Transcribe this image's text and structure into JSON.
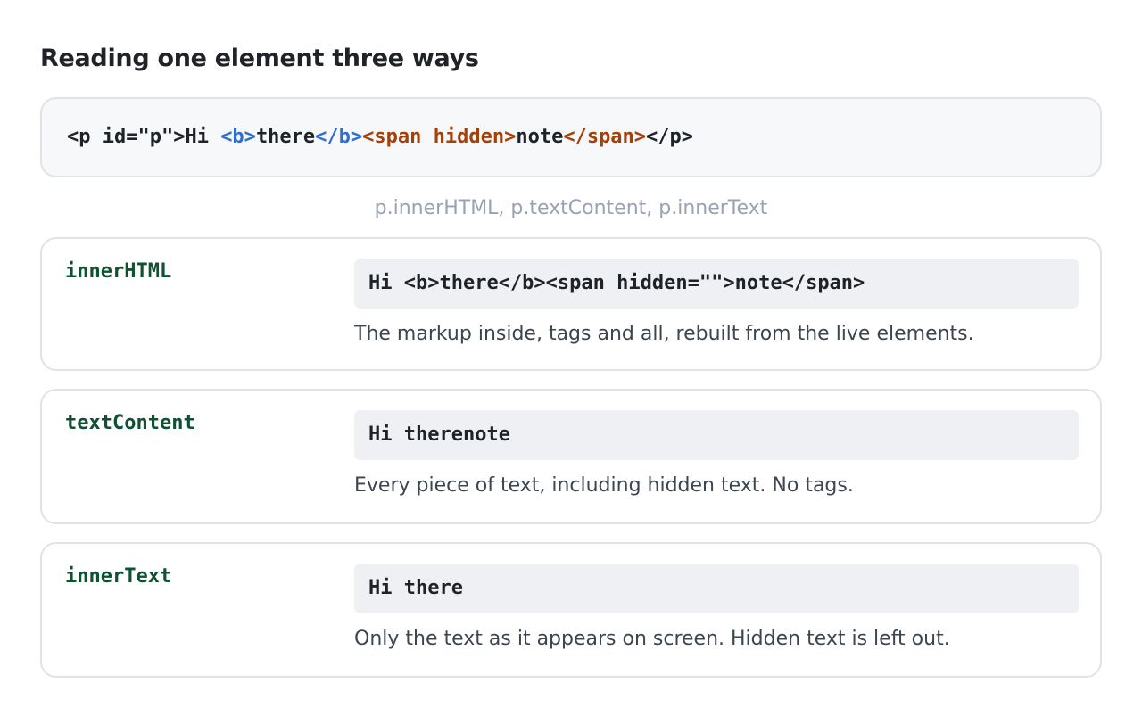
{
  "title": "Reading one element three ways",
  "source": {
    "tokens": [
      {
        "text": "<p id=\"p\">Hi ",
        "color": "default"
      },
      {
        "text": "<b>",
        "color": "blue"
      },
      {
        "text": "there",
        "color": "default"
      },
      {
        "text": "</b>",
        "color": "blue"
      },
      {
        "text": "<span hidden>",
        "color": "rust"
      },
      {
        "text": "note",
        "color": "default"
      },
      {
        "text": "</span>",
        "color": "rust"
      },
      {
        "text": "</p>",
        "color": "default"
      }
    ]
  },
  "caption": "p.innerHTML, p.textContent, p.innerText",
  "rows": [
    {
      "name": "innerHTML",
      "result": "Hi <b>there</b><span hidden=\"\">note</span>",
      "description": "The markup inside, tags and all, rebuilt from the live elements."
    },
    {
      "name": "textContent",
      "result": "Hi therenote",
      "description": "Every piece of text, including hidden text. No tags."
    },
    {
      "name": "innerText",
      "result": "Hi there",
      "description": "Only the text as it appears on screen. Hidden text is left out."
    }
  ],
  "colors": {
    "tag_blue": "#2f6fd0",
    "tag_rust": "#a4410b",
    "property_name": "#0f5132",
    "caption": "#98a2b3",
    "border": "#dfe3e8"
  }
}
